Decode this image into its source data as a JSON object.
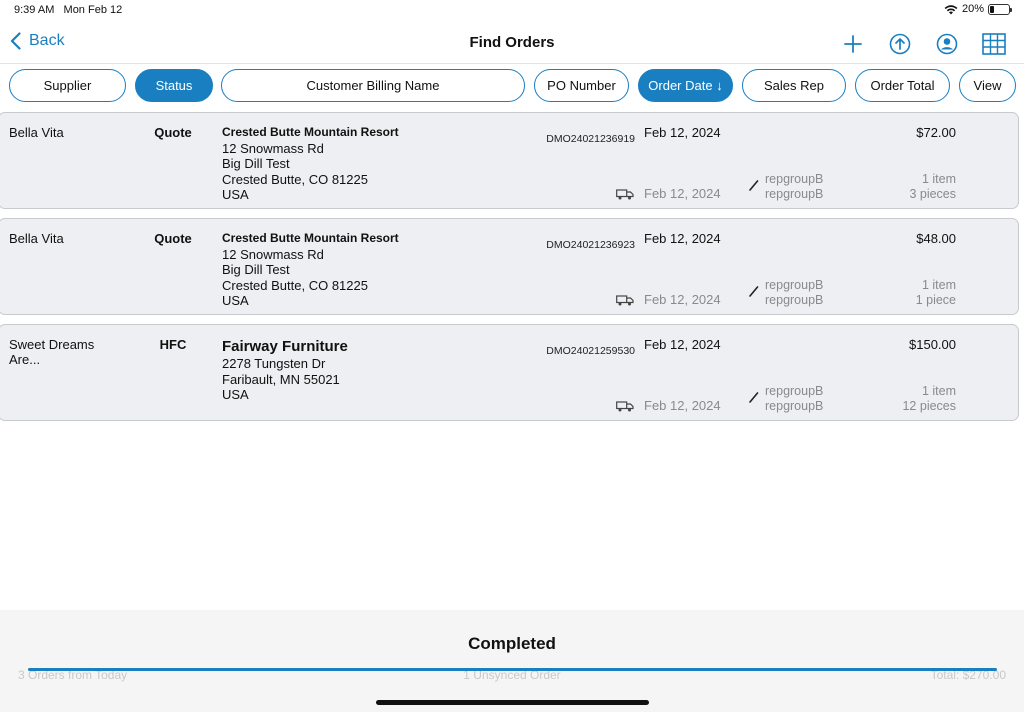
{
  "status_bar": {
    "time": "9:39 AM",
    "date": "Mon Feb 12",
    "battery": "20%",
    "battery_level": 0.2
  },
  "navbar": {
    "back_label": "Back",
    "title": "Find Orders",
    "icons": [
      "plus-icon",
      "upload-icon",
      "account-icon",
      "grid-view-icon"
    ]
  },
  "sort_chips": {
    "supplier": "Supplier",
    "status": "Status",
    "customer_billing_name": "Customer Billing Name",
    "po_number": "PO Number",
    "order_date": "Order Date ↓",
    "sales_rep": "Sales Rep",
    "order_total": "Order Total",
    "view": "View"
  },
  "orders": [
    {
      "supplier": "Bella Vita",
      "status": "Quote",
      "customer_name": "Crested Butte Mountain Resort",
      "address_line1": "12 Snowmass Rd",
      "address_line2": "Big Dill Test",
      "city_state_zip": "Crested Butte, CO  81225",
      "country": "USA",
      "po_number": "DMO24021236919",
      "order_date": "Feb 12, 2024",
      "ship_date": "Feb 12, 2024",
      "rep_1": "repgroupB",
      "rep_2": "repgroupB",
      "total": "$72.00",
      "items": "1 item",
      "pieces": "3 pieces"
    },
    {
      "supplier": "Bella Vita",
      "status": "Quote",
      "customer_name": "Crested Butte Mountain Resort",
      "address_line1": "12 Snowmass Rd",
      "address_line2": "Big Dill Test",
      "city_state_zip": "Crested Butte, CO  81225",
      "country": "USA",
      "po_number": "DMO24021236923",
      "order_date": "Feb 12, 2024",
      "ship_date": "Feb 12, 2024",
      "rep_1": "repgroupB",
      "rep_2": "repgroupB",
      "total": "$48.00",
      "items": "1 item",
      "pieces": "1 piece"
    },
    {
      "supplier": "Sweet Dreams Are...",
      "status": "HFC",
      "customer_name": "Fairway Furniture",
      "address_line1": "2278 Tungsten Dr",
      "city_state_zip": "Faribault, MN  55021",
      "country": "USA",
      "po_number": "DMO24021259530",
      "order_date": "Feb 12, 2024",
      "ship_date": "Feb 12, 2024",
      "rep_1": "repgroupB",
      "rep_2": "repgroupB",
      "total": "$150.00",
      "items": "1 item",
      "pieces": "12 pieces"
    }
  ],
  "footer": {
    "completed_label": "Completed",
    "orders_count": "3 Orders from Today",
    "unsynced": "1 Unsynced Order",
    "total": "Total: $270.00",
    "progress": 1.0
  },
  "colors": {
    "accent": "#1a7fc1",
    "row_bg": "#eeeff2",
    "muted": "#8a8a8e"
  }
}
